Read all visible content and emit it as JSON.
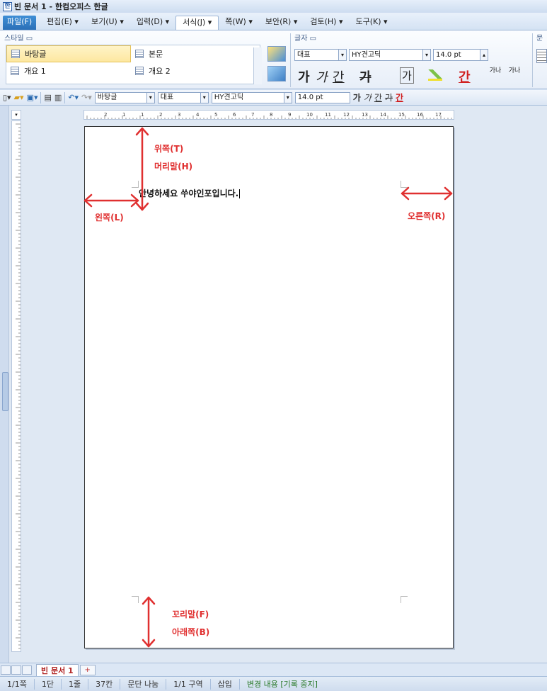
{
  "window": {
    "title": "빈 문서 1 - 한컴오피스 한글",
    "icon_label": "한"
  },
  "menu": [
    {
      "label": "파일(F)"
    },
    {
      "label": "편집(E) ▾"
    },
    {
      "label": "보기(U) ▾"
    },
    {
      "label": "입력(D) ▾"
    },
    {
      "label": "서식(J) ▾"
    },
    {
      "label": "쪽(W) ▾"
    },
    {
      "label": "보안(R) ▾"
    },
    {
      "label": "검토(H) ▾"
    },
    {
      "label": "도구(K) ▾"
    }
  ],
  "ribbon": {
    "style_group_label": "스타일 ▭",
    "font_group_label": "글자 ▭",
    "para_group_label": "문",
    "styles": [
      "바탕글",
      "본문",
      "개요 1",
      "개요 2"
    ],
    "font_lang": "대표",
    "font_name": "HY견고딕",
    "font_size": "14.0",
    "font_unit": "pt",
    "glyph_bold": "가",
    "glyph_italic": "가",
    "glyph_underline": "간",
    "glyph_strike": "가",
    "glyph_box": "가",
    "glyph_color": "간",
    "glyph_spacing_1": "가나",
    "glyph_spacing_2": "가나"
  },
  "toolbar": {
    "style_value": "바탕글",
    "font_lang": "대표",
    "font_name": "HY견고딕",
    "font_size": "14.0",
    "font_unit": "pt",
    "glyph_bold": "가",
    "glyph_italic": "가",
    "glyph_underline": "간",
    "glyph_strike": "가",
    "glyph_color": "간"
  },
  "document": {
    "text": "안녕하세요 쑤야인포입니다."
  },
  "annotations": {
    "top": "위쪽(T)",
    "header": "머리말(H)",
    "left": "왼쪽(L)",
    "right": "오른쪽(R)",
    "footer": "꼬리말(F)",
    "bottom": "아래쪽(B)",
    "color": "#e03030"
  },
  "ruler_numbers": [
    "2",
    "1",
    "1",
    "2",
    "3",
    "4",
    "5",
    "6",
    "7",
    "8",
    "9",
    "10",
    "11",
    "12",
    "13",
    "14",
    "15",
    "16",
    "17",
    "18"
  ],
  "tabs": {
    "doc_tab": "빈 문서 1",
    "new_tab_glyph": "+"
  },
  "status": {
    "page": "1/1쪽",
    "column": "1단",
    "line": "1줄",
    "char": "37칸",
    "section_break": "문단 나눔",
    "section": "1/1 구역",
    "insert_mode": "삽입",
    "track_changes": "변경 내용 [기록 중지]"
  }
}
